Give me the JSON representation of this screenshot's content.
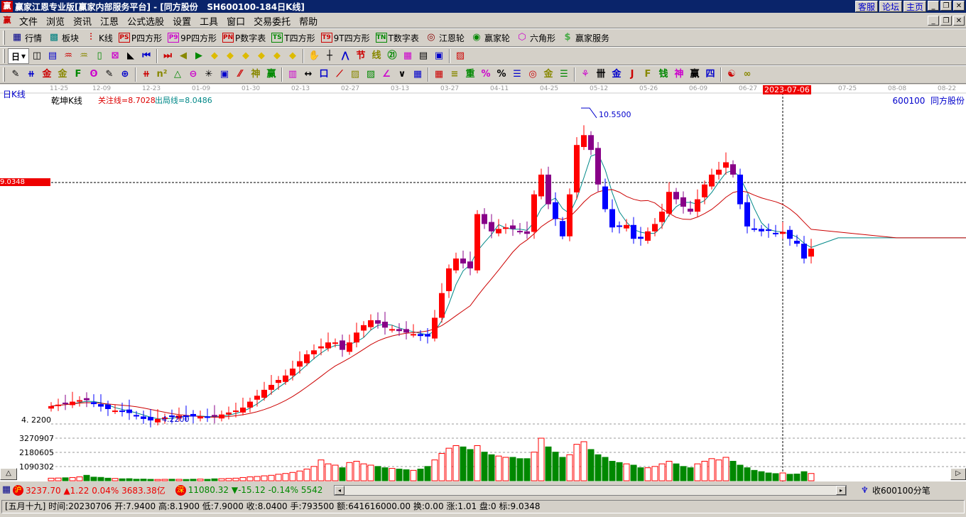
{
  "window": {
    "logo": "赢",
    "title": "赢家江恩专业版[赢家内部服务平台] - [同方股份   SH600100-184日K线]",
    "links": [
      "客服",
      "论坛",
      "主页"
    ],
    "min": "_",
    "restore": "❐",
    "close": "✕"
  },
  "menu": [
    "文件",
    "浏览",
    "资讯",
    "江恩",
    "公式选股",
    "设置",
    "工具",
    "窗口",
    "交易委托",
    "帮助"
  ],
  "toolbar1": [
    {
      "icon": "▦",
      "label": "行情",
      "name": "quotes",
      "color": "#00008b"
    },
    {
      "icon": "▩",
      "label": "板块",
      "name": "sectors",
      "color": "#008080"
    },
    {
      "icon": "⫶",
      "label": "K线",
      "name": "kline",
      "color": "#c00"
    },
    {
      "icon": "PS",
      "label": "P四方形",
      "name": "p-square",
      "color": "#c00"
    },
    {
      "icon": "P9",
      "label": "9P四方形",
      "name": "9p-square",
      "color": "#c0c"
    },
    {
      "icon": "PN",
      "label": "P数字表",
      "name": "p-number-table",
      "color": "#c00"
    },
    {
      "icon": "TS",
      "label": "T四方形",
      "name": "t-square",
      "color": "#080"
    },
    {
      "icon": "T9",
      "label": "9T四方形",
      "name": "9t-square",
      "color": "#c00"
    },
    {
      "icon": "TN",
      "label": "T数字表",
      "name": "t-number-table",
      "color": "#080"
    },
    {
      "icon": "◎",
      "label": "江恩轮",
      "name": "gann-wheel",
      "color": "#800"
    },
    {
      "icon": "◉",
      "label": "赢家轮",
      "name": "winner-wheel",
      "color": "#080"
    },
    {
      "icon": "⬡",
      "label": "六角形",
      "name": "hexagon",
      "color": "#c0c"
    },
    {
      "icon": "$",
      "label": "赢家服务",
      "name": "winner-service",
      "color": "#4a4"
    }
  ],
  "toolbar2": {
    "period": "日",
    "icons": [
      "◫",
      "▤",
      "♒",
      "♒",
      "▯",
      "⊠",
      "◣",
      "⏮",
      "⏭",
      "◀",
      "▶",
      "◆",
      "◆",
      "◆",
      "◆",
      "◆",
      "◆",
      "✋",
      "┼",
      "⋀",
      "节",
      "线",
      "㉑",
      "▦",
      "▤",
      "▣",
      "▨"
    ]
  },
  "toolbar3": {
    "icons": [
      "✎",
      "⧺",
      "金",
      "金",
      "F",
      "ʘ",
      "✎",
      "⊕",
      "⧺",
      "n²",
      "△",
      "⊖",
      "✳",
      "▣",
      "⁄⁄",
      "神",
      "赢",
      "▥",
      "↔",
      "口",
      "⟋",
      "▨",
      "▨",
      "∠",
      "∨",
      "▦",
      "▦",
      "≡",
      "重",
      "%",
      "%",
      "☰",
      "◎",
      "金",
      "☰",
      "⚘",
      "卌",
      "金",
      "J",
      "F",
      "钱",
      "神",
      "赢",
      "四",
      "☯",
      "∞"
    ]
  },
  "chart": {
    "period_label": "日K线",
    "indicator": "乾坤K线",
    "focus_line": "关注线=8.7028",
    "exit_line": "出局线=8.0486",
    "stock": "600100  同方股份",
    "crosshair_price": "9.0348",
    "high_label": "10.5500",
    "low_label": "4.2200",
    "low_axis": "4. 2200",
    "vol_ticks": [
      "3270907",
      "2180605",
      "1090302"
    ],
    "dates": [
      "11-25",
      "12-09",
      "12-23",
      "01-09",
      "01-30",
      "02-13",
      "02-27",
      "03-13",
      "03-27",
      "04-11",
      "04-25",
      "05-12",
      "05-26",
      "06-09",
      "06-27",
      "2023-07-06",
      "07-25",
      "08-08",
      "08-22"
    ],
    "scroll_up": "△"
  },
  "chart_data": {
    "type": "candlestick",
    "title": "SH600100-184日K线",
    "ylim": [
      4.22,
      10.55
    ],
    "crosshair": 9.0348,
    "close": [
      4.51,
      4.54,
      4.57,
      4.6,
      4.63,
      4.63,
      4.55,
      4.5,
      4.45,
      4.42,
      4.4,
      4.37,
      4.3,
      4.25,
      4.22,
      4.25,
      4.28,
      4.3,
      4.32,
      4.31,
      4.3,
      4.3,
      4.29,
      4.3,
      4.34,
      4.38,
      4.42,
      4.48,
      4.6,
      4.72,
      4.84,
      4.94,
      5.04,
      5.13,
      5.27,
      5.42,
      5.56,
      5.64,
      5.72,
      5.8,
      5.8,
      5.65,
      5.8,
      6.0,
      6.15,
      6.25,
      6.18,
      6.1,
      6.07,
      6.03,
      6.0,
      5.97,
      5.93,
      5.92,
      6.3,
      6.8,
      7.3,
      7.5,
      7.4,
      7.3,
      8.4,
      8.2,
      8.05,
      8.1,
      8.13,
      8.1,
      8.05,
      8.0,
      8.8,
      9.2,
      8.6,
      8.3,
      7.95,
      8.8,
      9.8,
      10.0,
      9.7,
      9.0,
      8.5,
      8.13,
      8.15,
      8.18,
      7.9,
      7.9,
      8.05,
      8.2,
      8.45,
      8.85,
      8.7,
      8.55,
      8.45,
      8.7,
      9.0,
      9.2,
      9.3,
      9.45,
      9.2,
      8.6,
      8.15,
      8.1,
      8.05,
      8.06,
      8.0,
      8.04,
      7.9,
      7.8,
      7.5,
      7.7
    ],
    "volume": [
      200,
      210,
      230,
      250,
      300,
      420,
      280,
      260,
      200,
      180,
      150,
      160,
      120,
      130,
      110,
      100,
      110,
      120,
      110,
      100,
      120,
      130,
      110,
      150,
      160,
      180,
      200,
      250,
      300,
      330,
      380,
      420,
      500,
      560,
      640,
      750,
      900,
      1100,
      1600,
      1300,
      1200,
      1000,
      1400,
      1500,
      1300,
      1200,
      1100,
      1000,
      950,
      900,
      850,
      800,
      900,
      1100,
      1600,
      2100,
      2500,
      2700,
      2600,
      2400,
      2700,
      2200,
      2000,
      1900,
      1800,
      1800,
      1700,
      1700,
      2200,
      3270,
      2600,
      2200,
      1800,
      2000,
      2800,
      3000,
      2400,
      2000,
      1800,
      1500,
      1400,
      1300,
      1200,
      1000,
      1000,
      1100,
      1300,
      1500,
      1300,
      1100,
      1000,
      1300,
      1500,
      1700,
      1600,
      1800,
      1500,
      1200,
      1000,
      800,
      700,
      600,
      550,
      600,
      500,
      520,
      700,
      560
    ]
  },
  "status": {
    "sh_badge": "沪",
    "sh": "3237.70 ▲1.22 0.04% 3683.38亿",
    "sz_badge": "深",
    "sz": "11080.32 ▼-15.12 -0.14% 5542.3",
    "ticks": "收600100分笔",
    "left": "◂",
    "right": "▸"
  },
  "info": "[五月十九] 时间:20230706 开:7.9400 高:8.1900 低:7.9000 收:8.0400 手:793500 额:641616000.00 换:0.00 涨:1.01 盘:0 标:9.0348"
}
